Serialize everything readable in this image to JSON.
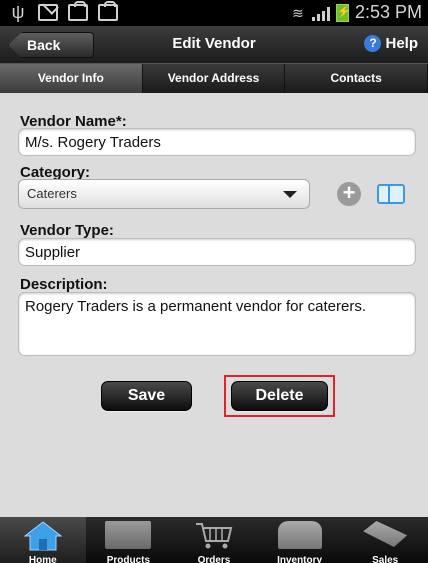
{
  "status_bar": {
    "time": "2:53 PM",
    "icons": [
      "usb-icon",
      "mail-icon",
      "bag-icon",
      "bag-check-icon",
      "wifi-icon",
      "signal-icon",
      "battery-icon"
    ]
  },
  "action_bar": {
    "back_label": "Back",
    "title": "Edit Vendor",
    "help_label": "Help",
    "help_icon_glyph": "?"
  },
  "tabs": [
    {
      "label": "Vendor Info",
      "active": true
    },
    {
      "label": "Vendor Address",
      "active": false
    },
    {
      "label": "Contacts",
      "active": false
    }
  ],
  "form": {
    "vendor_name_label": "Vendor Name*:",
    "vendor_name_value": "M/s. Rogery Traders",
    "category_label": "Category:",
    "category_value": "Caterers",
    "vendor_type_label": "Vendor Type:",
    "vendor_type_value": "Supplier",
    "description_label": "Description:",
    "description_value": "Rogery Traders is a permanent vendor for caterers."
  },
  "buttons": {
    "save_label": "Save",
    "delete_label": "Delete"
  },
  "highlight_color": "#e0222b",
  "bottom_nav": [
    {
      "label": "Home",
      "icon": "home-icon",
      "active": true
    },
    {
      "label": "Products",
      "icon": "products-icon",
      "active": false
    },
    {
      "label": "Orders",
      "icon": "cart-icon",
      "active": false
    },
    {
      "label": "Inventory",
      "icon": "inventory-icon",
      "active": false
    },
    {
      "label": "Sales",
      "icon": "sales-tag-icon",
      "active": false
    }
  ]
}
